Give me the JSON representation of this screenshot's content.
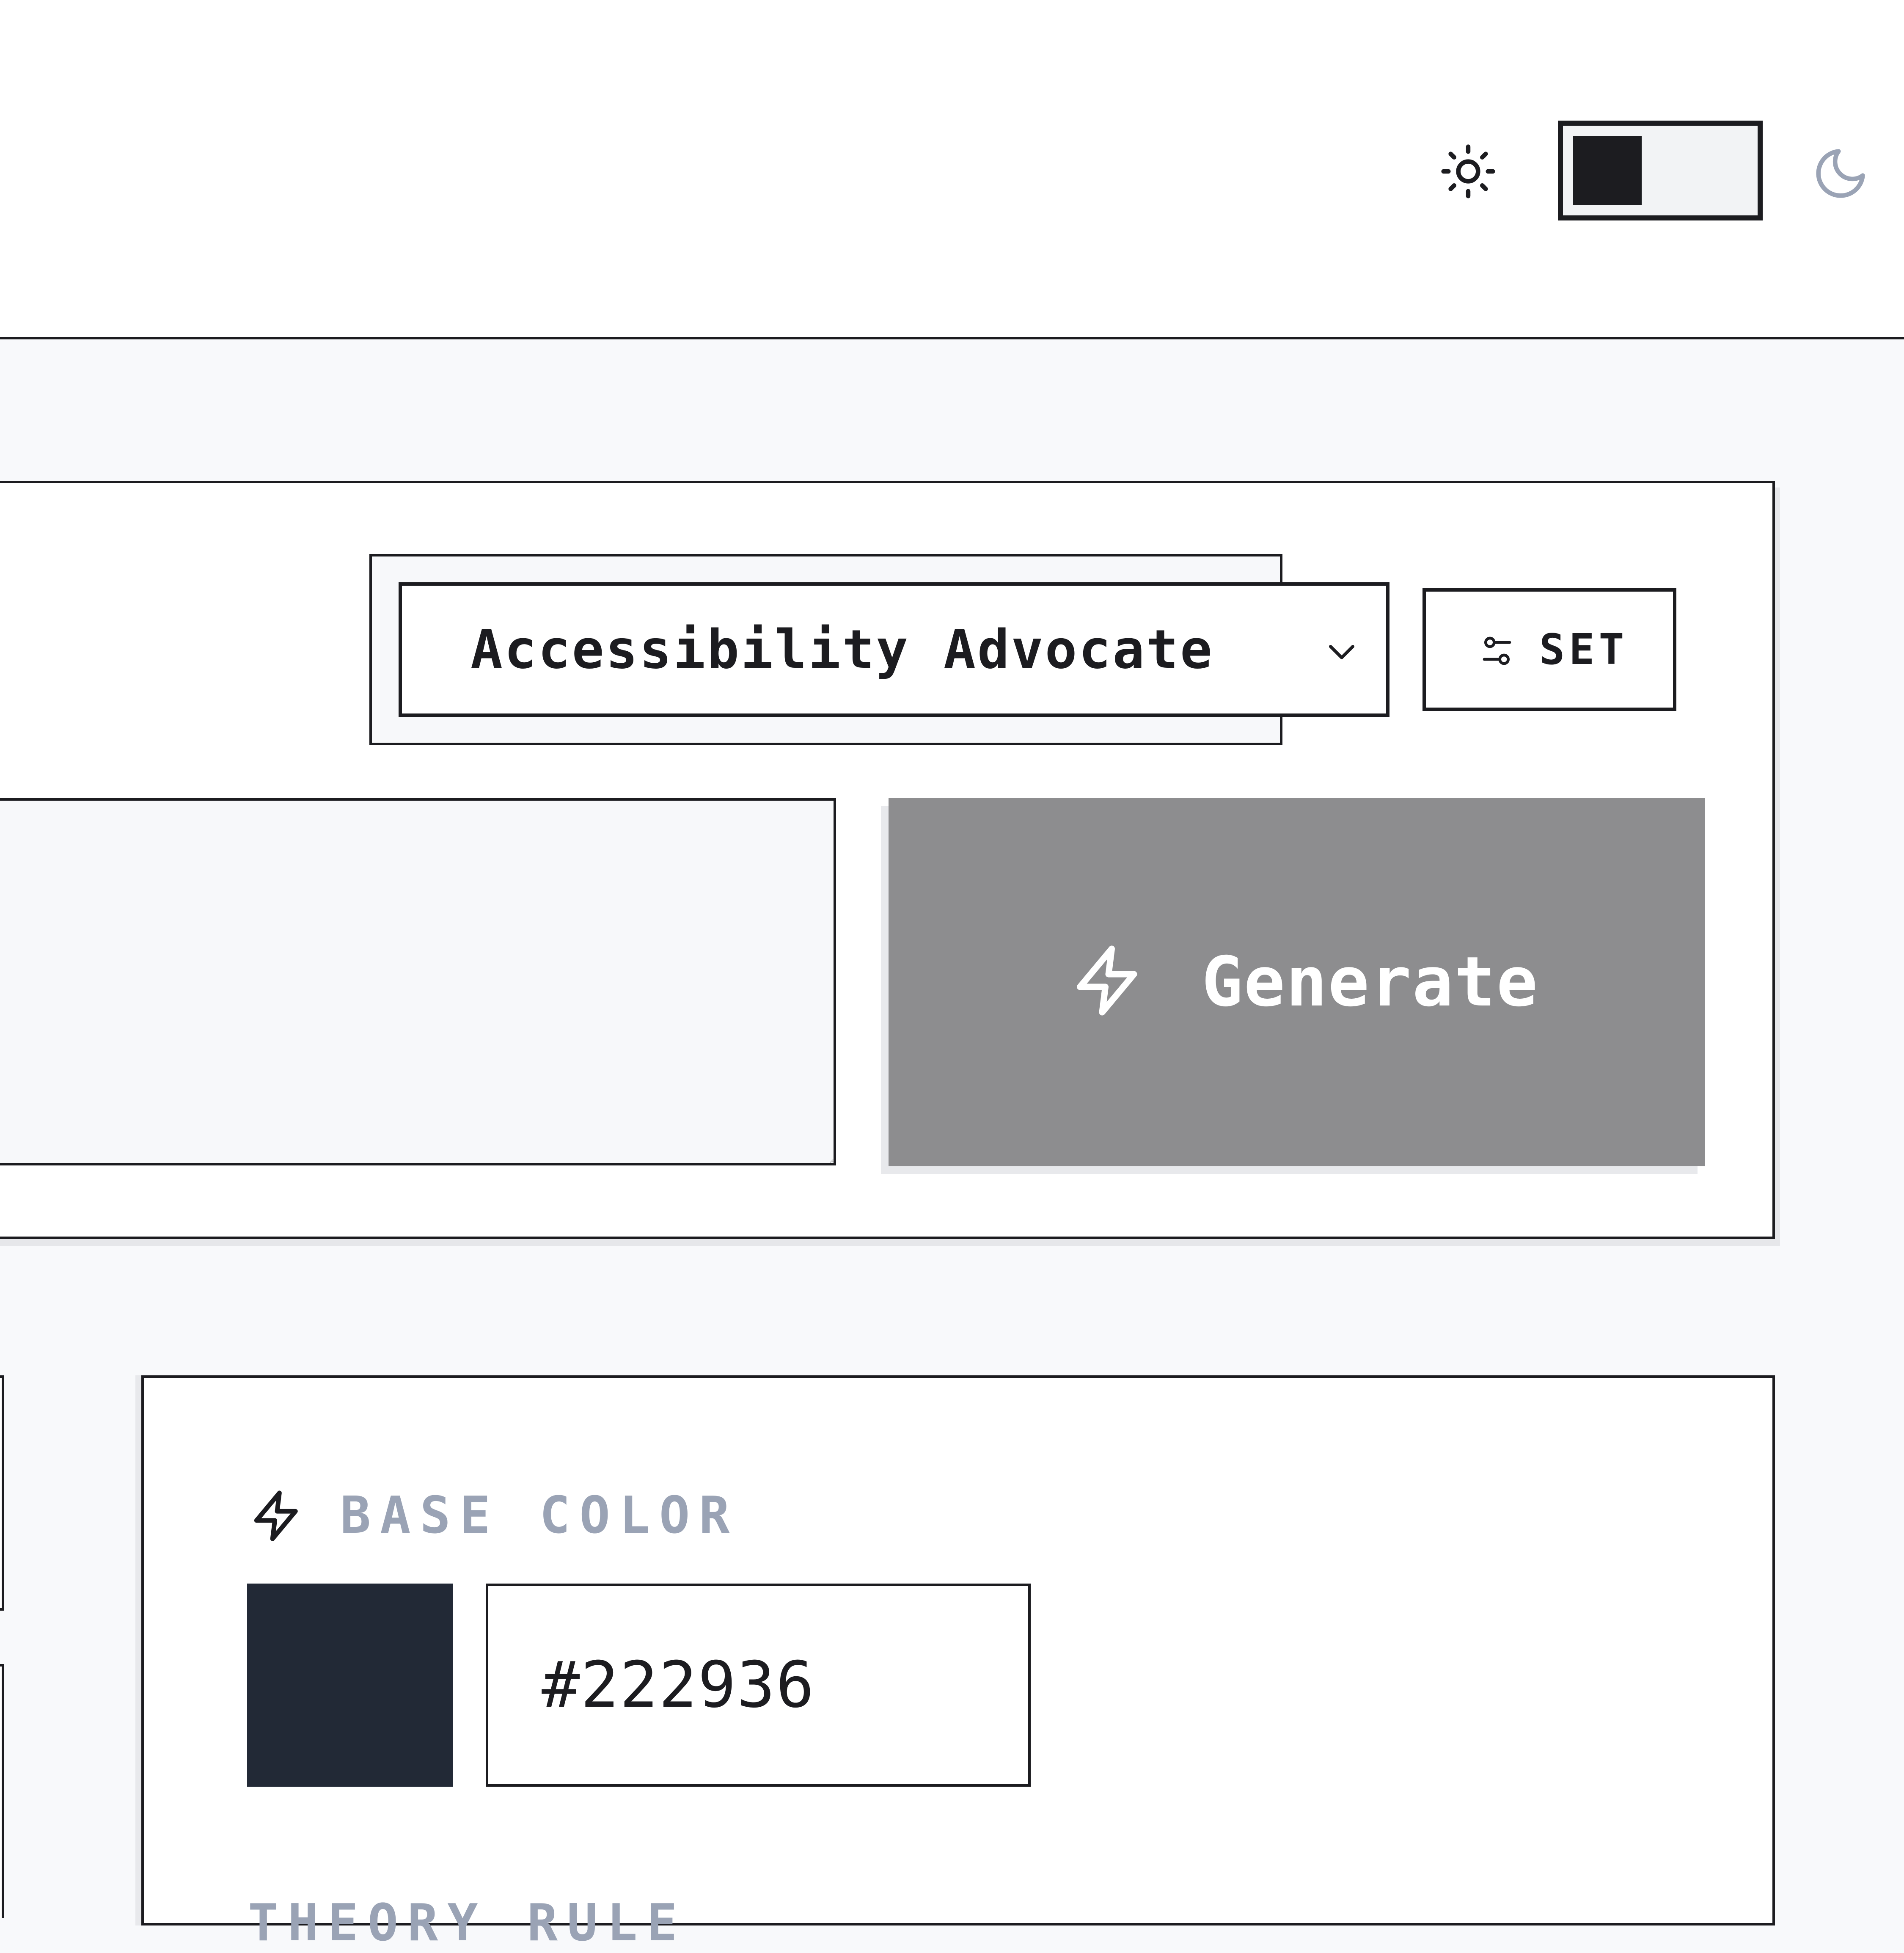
{
  "header": {
    "theme_toggle": {
      "mode": "light",
      "icons": [
        "sun-icon",
        "moon-icon"
      ]
    }
  },
  "controls": {
    "persona_select": {
      "value": "Accessibility Advocate",
      "icon": "chevron-down-icon"
    },
    "set_button": {
      "label": "SET",
      "icon": "sliders-icon"
    },
    "prompt_input": {
      "value": ""
    },
    "generate_button": {
      "label": "Generate",
      "icon": "lightning-icon",
      "color": "#8d8d8f"
    }
  },
  "palette": {
    "base_color": {
      "label": "BASE COLOR",
      "icon": "lightning-icon",
      "value": "#222936",
      "swatch_color": "#222936"
    },
    "theory_rule": {
      "label": "THEORY RULE"
    }
  }
}
